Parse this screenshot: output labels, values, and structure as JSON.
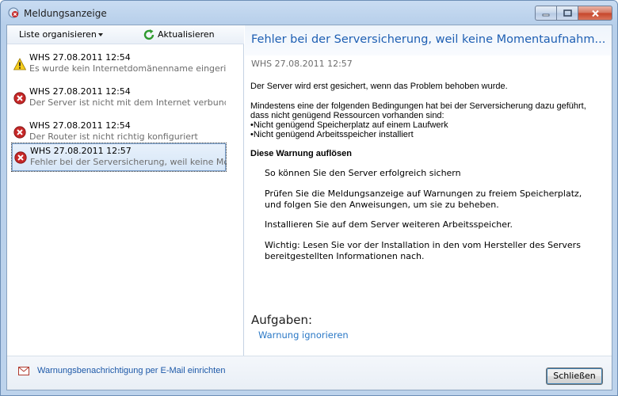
{
  "window": {
    "title": "Meldungsanzeige"
  },
  "toolbar": {
    "organize_label": "Liste organisieren",
    "refresh_label": "Aktualisieren"
  },
  "alerts": [
    {
      "severity": "warning",
      "title": "WHS 27.08.2011 12:54",
      "desc": "Es wurde kein Internetdomänenname eingeric...",
      "selected": false
    },
    {
      "severity": "error",
      "title": "WHS 27.08.2011 12:54",
      "desc": "Der Server ist nicht mit dem Internet verbunden",
      "selected": false
    },
    {
      "severity": "error",
      "title": "WHS 27.08.2011 12:54",
      "desc": "Der Router ist nicht richtig konfiguriert",
      "selected": false
    },
    {
      "severity": "error",
      "title": "WHS 27.08.2011 12:57",
      "desc": "Fehler bei der Serversicherung, weil keine Mo...",
      "selected": true
    }
  ],
  "detail": {
    "title": "Fehler bei der Serversicherung, weil keine Momentaufnahm...",
    "date": "WHS 27.08.2011 12:57",
    "para1": "Der Server wird erst gesichert, wenn das Problem behoben wurde.",
    "para2_line1": "Mindestens eine der folgenden Bedingungen hat bei der Serversicherung dazu geführt,",
    "para2_line2": "dass nicht genügend Ressourcen vorhanden sind:",
    "bullet1": "•Nicht genügend Speicherplatz auf einem Laufwerk",
    "bullet2": "•Nicht genügend Arbeitsspeicher installiert",
    "resolve_heading": "Diese Warnung auflösen",
    "resolve_intro": "So können Sie den Server erfolgreich sichern",
    "step1_line1": "Prüfen Sie die Meldungsanzeige auf Warnungen zu freiem Speicherplatz,",
    "step1_line2": "und folgen Sie den Anweisungen, um sie zu beheben.",
    "step2": "Installieren Sie auf dem Server weiteren Arbeitsspeicher.",
    "step3_line1": "Wichtig: Lesen Sie vor der Installation in den vom Hersteller des Servers",
    "step3_line2": "bereitgestellten Informationen nach.",
    "tasks_heading": "Aufgaben:",
    "task_ignore": "Warnung ignorieren"
  },
  "footer": {
    "email_link": "Warnungsbenachrichtigung per E-Mail einrichten",
    "close_label": "Schließen"
  },
  "colors": {
    "accent": "#1e5fb3",
    "link": "#2a78c6",
    "error": "#c62828",
    "warning": "#f2c100"
  },
  "icons": {
    "warning": "warning-triangle-icon",
    "error": "error-circle-icon",
    "refresh": "refresh-icon",
    "email": "email-icon"
  }
}
